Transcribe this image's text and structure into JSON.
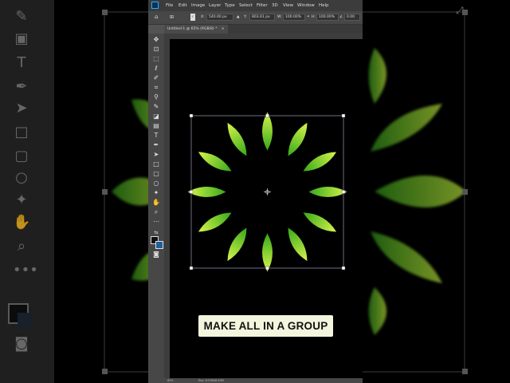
{
  "menu": {
    "items": [
      "File",
      "Edit",
      "Image",
      "Layer",
      "Type",
      "Select",
      "Filter",
      "3D",
      "View",
      "Window",
      "Help"
    ]
  },
  "options_bar": {
    "x_label": "X:",
    "x_value": "540.00 px",
    "y_label": "Y:",
    "y_value": "803.61 px",
    "w_label": "W:",
    "w_value": "100.00%",
    "h_label": "H:",
    "h_value": "100.00%",
    "angle_value": "0.00"
  },
  "document": {
    "tab_title": "Untitled-1 @ 65% (RGB/8) *",
    "zoom": "65%",
    "status_text": "Doc: 6.59M/6.59M"
  },
  "caption": {
    "text": "MAKE ALL IN A GROUP"
  },
  "artwork": {
    "shape": "leaf",
    "leaf_count": 12,
    "gradient": [
      "#35a81a",
      "#d8f54a"
    ],
    "background": "#000000",
    "selection_color": "#ffffff"
  },
  "icons": [
    "move-icon",
    "artboard-icon",
    "marquee-icon",
    "lasso-icon",
    "quick-select-icon",
    "crop-icon",
    "eyedropper-icon",
    "brush-icon",
    "eraser-icon",
    "gradient-icon",
    "type-icon",
    "pen-icon",
    "path-select-icon",
    "rectangle-icon",
    "hand-icon",
    "zoom-icon",
    "more-tools-icon",
    "swap-colors-icon",
    "quick-mask-icon",
    "screen-mode-icon"
  ]
}
